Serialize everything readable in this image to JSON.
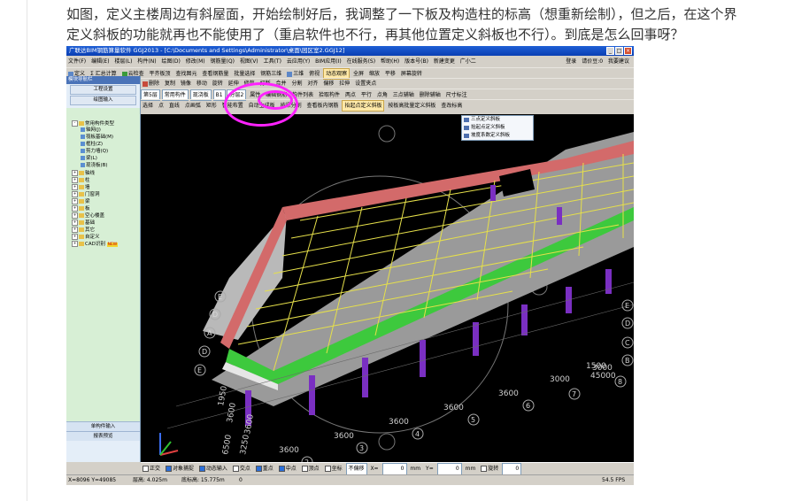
{
  "question": {
    "line1": "如图，定义主楼周边有斜屋面，开始绘制好后，我调整了一下板及构造柱的标高（想重新绘制），但之后，在这个界",
    "line2": "定义斜板的功能就再也不能使用了（重启软件也不行，再其他位置定义斜板也不行）。到底是怎么回事呀？"
  },
  "app": {
    "title": "广联达BIM钢筋算量软件 GGJ2013 - [C:\\Documents and Settings\\Administrator\\桌面\\园区室2.GGJ12]",
    "menu": [
      "文件(F)",
      "编辑(E)",
      "楼层(L)",
      "构件(N)",
      "绘图(D)",
      "修改(M)",
      "钢筋量(Q)",
      "视图(V)",
      "工具(T)",
      "云应用(Y)",
      "BIM应用(I)",
      "在线服务(S)",
      "帮助(H)",
      "版本号(B)",
      "新建变更",
      "广小二"
    ],
    "menu_right": [
      "登录",
      "请价豆:0",
      "我要建议"
    ],
    "toolbar1": [
      "定义",
      "Σ 汇总计算",
      "云检查",
      "平齐板顶",
      "查找图元",
      "查看钢筋量",
      "批量选择",
      "钢筋三维",
      "三维",
      "俯视",
      "动态观察",
      "全屏",
      "缩放",
      "平移",
      "屏幕旋转"
    ],
    "toolbar2": [
      "删除",
      "复制",
      "镜像",
      "移动",
      "旋转",
      "延伸",
      "修剪",
      "打断",
      "合并",
      "分割",
      "对齐",
      "偏移",
      "拉伸",
      "设置夹点"
    ],
    "toolbar3": {
      "floor": "第5层",
      "category": "常用构件",
      "type": "现浇板",
      "name": "B1",
      "layer": "分层2",
      "items": [
        "属性",
        "编辑钢筋",
        "构件列表",
        "拾取构件",
        "两点",
        "平行",
        "点角",
        "三点辅轴",
        "删除辅轴",
        "尺寸标注"
      ]
    },
    "toolbar4": [
      "选择",
      "点",
      "直线",
      "点画弧",
      "矩形",
      "智能布置",
      "自动生成板",
      "按梁分割",
      "查看板内钢筋",
      "抬起点定义斜板",
      "按板高批量定义斜板",
      "查改标高"
    ],
    "nav": {
      "title": "模块导航栏",
      "buttons": [
        "工程设置",
        "绘图输入"
      ],
      "tree": [
        {
          "label": "常用构件类型",
          "kind": "folder"
        },
        {
          "label": "轴网(J)",
          "kind": "leaf"
        },
        {
          "label": "筏板基础(M)",
          "kind": "leaf"
        },
        {
          "label": "框柱(Z)",
          "kind": "leaf"
        },
        {
          "label": "剪力墙(Q)",
          "kind": "leaf"
        },
        {
          "label": "梁(L)",
          "kind": "leaf"
        },
        {
          "label": "现浇板(B)",
          "kind": "leaf"
        },
        {
          "label": "轴线",
          "kind": "folder"
        },
        {
          "label": "柱",
          "kind": "folder"
        },
        {
          "label": "墙",
          "kind": "folder"
        },
        {
          "label": "门窗洞",
          "kind": "folder"
        },
        {
          "label": "梁",
          "kind": "folder"
        },
        {
          "label": "板",
          "kind": "folder"
        },
        {
          "label": "空心楼盖",
          "kind": "folder"
        },
        {
          "label": "基础",
          "kind": "folder"
        },
        {
          "label": "其它",
          "kind": "folder"
        },
        {
          "label": "自定义",
          "kind": "folder"
        },
        {
          "label": "CAD识别",
          "kind": "folder"
        }
      ],
      "new_badge": "NEW",
      "bottom": [
        "单构件输入",
        "报表预览"
      ]
    },
    "context_menu": [
      "三点定义斜板",
      "抬起点定义斜板",
      "坡度系数定义斜板"
    ],
    "status1": [
      "正交",
      "对象捕捉",
      "动态输入",
      "交点",
      "重点",
      "中点",
      "顶点",
      "坐标",
      "不偏移",
      "X=",
      "0",
      "mm",
      "Y=",
      "0",
      "mm",
      "旋转",
      "0"
    ],
    "status2": {
      "coords": "X=8096  Y=49085",
      "floor_height": "层高: 4.025m",
      "base_height": "底标高: 15.775m",
      "zero": "0",
      "fps": "54.5 FPS"
    },
    "viewport_labels": {
      "dims": [
        "3600",
        "3600",
        "3600",
        "3600",
        "3600",
        "3000",
        "3000",
        "1500",
        "45000",
        "3600",
        "6500",
        "3250",
        "3600",
        "1950"
      ],
      "axes": [
        "1",
        "2",
        "3",
        "4",
        "5",
        "6",
        "7",
        "8",
        "E",
        "E",
        "D",
        "D",
        "C",
        "B",
        "A",
        "D",
        "E"
      ]
    }
  }
}
